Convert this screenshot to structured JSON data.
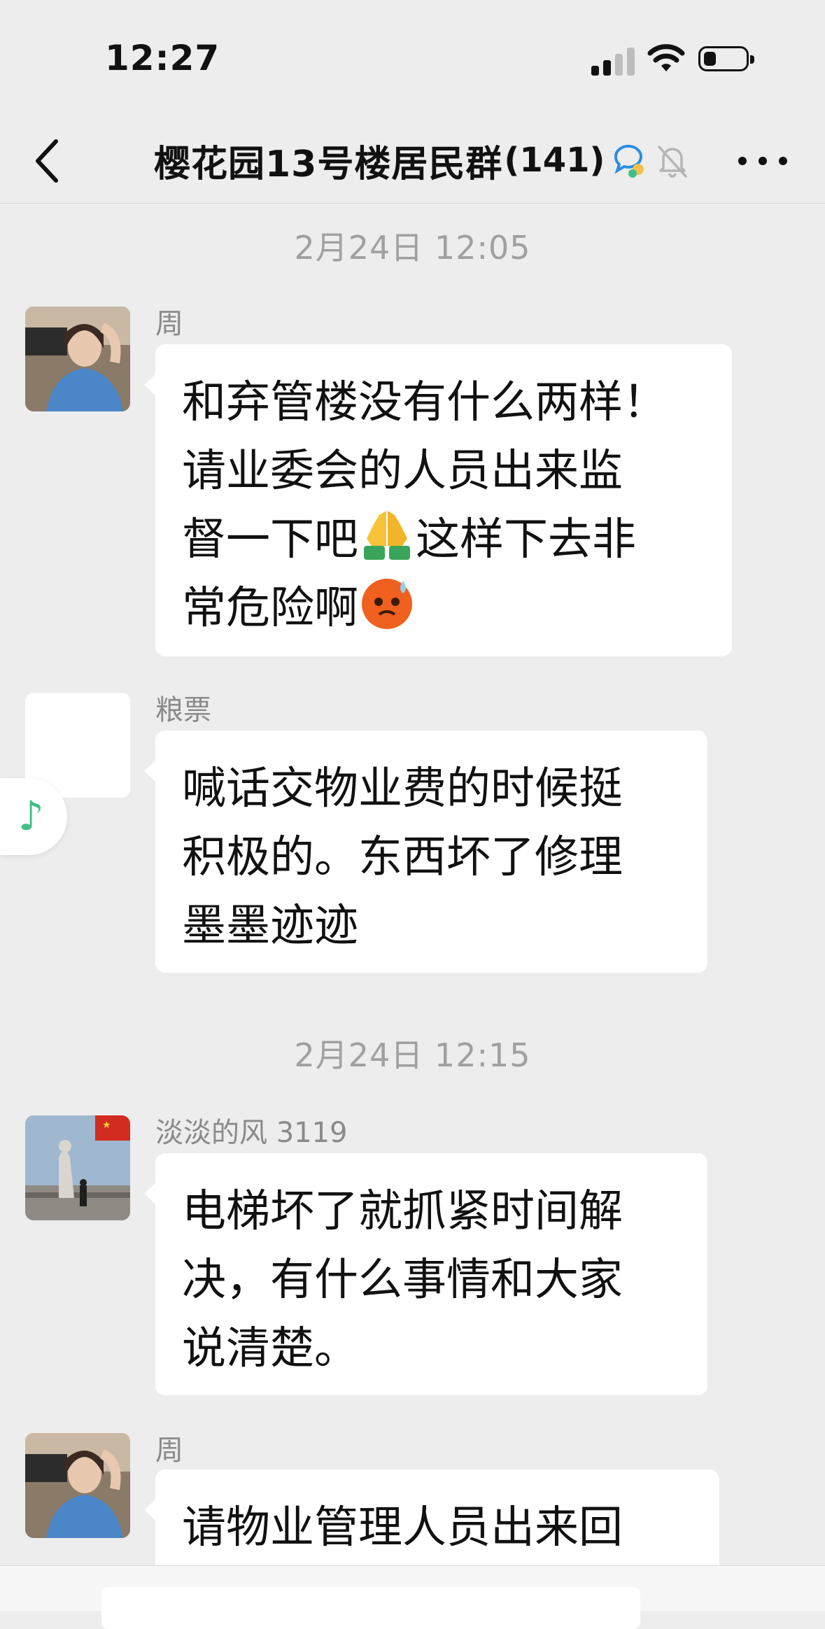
{
  "status_bar": {
    "time": "12:27",
    "battery_level": 0.3
  },
  "header": {
    "title": "樱花园13号楼居民群",
    "member_count": "(141)",
    "icons": [
      "back-icon",
      "chat-dots-icon",
      "mute-bell-icon",
      "more-icon"
    ]
  },
  "timestamps": [
    "2月24日 12:05",
    "2月24日 12:15"
  ],
  "messages": [
    {
      "sender": "周",
      "lines": [
        "和弃管楼没有什么两样！",
        "请业委会的人员出来监",
        "督一下吧",
        "这样下去非",
        "常危险啊"
      ],
      "emojis": [
        "folded-hands-emoji",
        "anxious-face-emoji"
      ]
    },
    {
      "sender": "粮票",
      "lines": [
        "喊话交物业费的时候挺",
        "积极的。东西坏了修理",
        "墨墨迹迹"
      ]
    },
    {
      "sender": "淡淡的风 3119",
      "lines": [
        "电梯坏了就抓紧时间解",
        "决，有什么事情和大家",
        "说清楚。"
      ]
    },
    {
      "sender": "周",
      "lines": [
        "请物业管理人员出来回"
      ]
    }
  ],
  "floating": {
    "icon": "music-note-icon",
    "glyph": "♪"
  },
  "colors": {
    "background": "#ededed",
    "bubble": "#ffffff",
    "timestamp": "#a0a0a0",
    "music": "#3fbf87"
  }
}
